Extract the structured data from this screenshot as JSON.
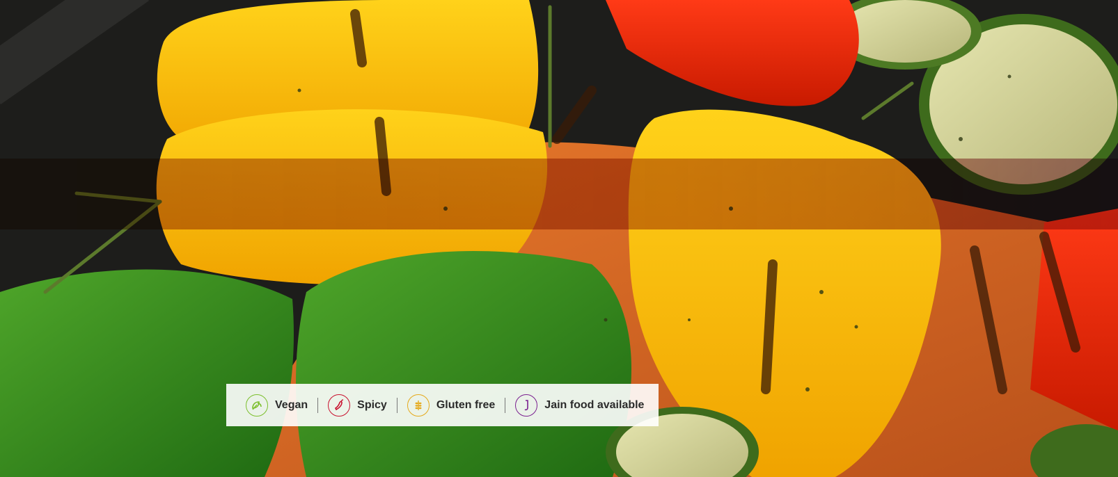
{
  "hero": {
    "image_icon": "grilled-vegetables-photo"
  },
  "dietary_legend": {
    "items": [
      {
        "label": "Vegan",
        "icon": "leaf-icon",
        "color": "#7cbf2d"
      },
      {
        "label": "Spicy",
        "icon": "chili-icon",
        "color": "#c8102e"
      },
      {
        "label": "Gluten free",
        "icon": "wheat-icon",
        "color": "#e5a91a"
      },
      {
        "label": "Jain food available",
        "icon": "jain-icon",
        "color": "#7a1f8f"
      }
    ]
  }
}
